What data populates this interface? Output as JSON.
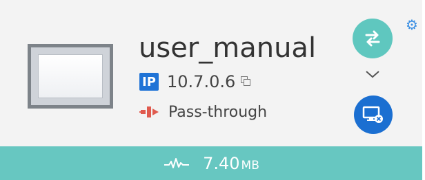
{
  "device": {
    "name": "user_manual",
    "ip_badge": "IP",
    "ip": "10.7.0.6",
    "mode": "Pass-through"
  },
  "traffic": {
    "value": "7.40",
    "unit": "MB"
  },
  "icons": {
    "settings": "gear-icon",
    "swap": "swap-arrows-icon",
    "expand": "chevron-down-icon",
    "remote": "remote-desktop-icon",
    "copy": "copy-icon",
    "mode": "pass-through-icon",
    "traffic": "pulse-icon"
  },
  "colors": {
    "teal": "#5fc7bf",
    "footer": "#67c7c1",
    "blue": "#1b6fd1",
    "ip_badge": "#1f73d6",
    "mode_red": "#e05a4e"
  }
}
